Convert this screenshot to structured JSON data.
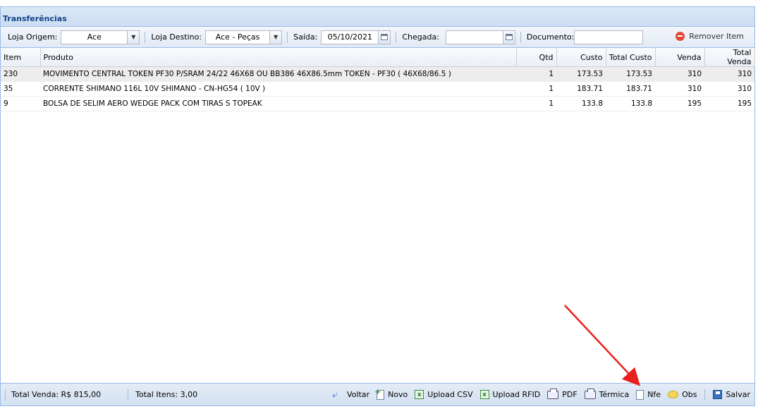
{
  "panel": {
    "title": "Transferências"
  },
  "toolbar": {
    "origem_label": "Loja Origem:",
    "origem_value": "Ace",
    "destino_label": "Loja Destino:",
    "destino_value": "Ace - Peças",
    "saida_label": "Saída:",
    "saida_value": "05/10/2021",
    "chegada_label": "Chegada:",
    "chegada_value": "",
    "documento_label": "Documento:",
    "documento_value": "",
    "remove_label": "Remover Item"
  },
  "grid": {
    "columns": [
      "Item",
      "Produto",
      "Qtd",
      "Custo",
      "Total Custo",
      "Venda",
      "Total Venda"
    ],
    "rows": [
      [
        "230",
        "MOVIMENTO CENTRAL TOKEN PF30 P/SRAM 24/22 46X68 OU BB386 46X86.5mm TOKEN - PF30 ( 46X68/86.5 )",
        "1",
        "173.53",
        "173.53",
        "310",
        "310"
      ],
      [
        "35",
        "CORRENTE SHIMANO 116L 10V SHIMANO - CN-HG54 ( 10V )",
        "1",
        "183.71",
        "183.71",
        "310",
        "310"
      ],
      [
        "9",
        "BOLSA DE SELIM AERO WEDGE PACK COM TIRAS S TOPEAK",
        "1",
        "133.8",
        "133.8",
        "195",
        "195"
      ]
    ]
  },
  "statusbar": {
    "total_venda": "Total Venda: R$ 815,00",
    "total_itens": "Total Itens: 3,00",
    "buttons": {
      "voltar": "Voltar",
      "novo": "Novo",
      "upload_csv": "Upload CSV",
      "upload_rfid": "Upload RFID",
      "pdf": "PDF",
      "termica": "Térmica",
      "nfe": "Nfe",
      "obs": "Obs",
      "salvar": "Salvar"
    }
  },
  "colors": {
    "annotation_arrow": "#e8201c",
    "panel_border": "#99bbe8",
    "title_text": "#15428b"
  }
}
